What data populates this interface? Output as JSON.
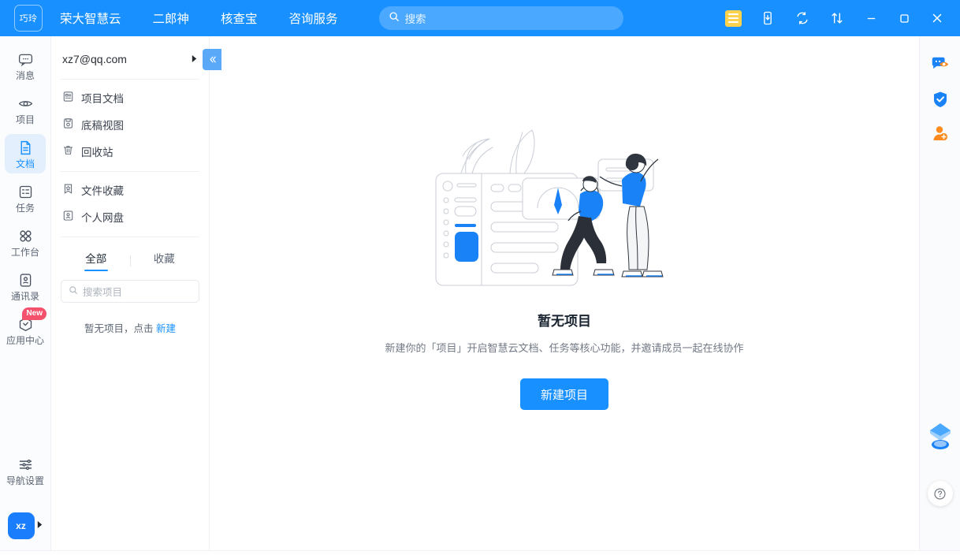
{
  "titlebar": {
    "logo_text": "巧玲",
    "nav_items": [
      {
        "label": "荣大智慧云"
      },
      {
        "label": "二郎神"
      },
      {
        "label": "核查宝"
      },
      {
        "label": "咨询服务"
      }
    ],
    "search_placeholder": "搜索",
    "tool_icons": [
      {
        "name": "note-icon"
      },
      {
        "name": "mobile-download-icon"
      },
      {
        "name": "sync-icon"
      },
      {
        "name": "transfer-icon"
      }
    ],
    "window_controls": [
      {
        "name": "minimize",
        "glyph": "−"
      },
      {
        "name": "maximize",
        "glyph": "▢"
      },
      {
        "name": "close",
        "glyph": "✕"
      }
    ],
    "accent_color": "#1890ff"
  },
  "sidebar": {
    "items": [
      {
        "label": "消息",
        "icon": "message-icon",
        "active": false
      },
      {
        "label": "项目",
        "icon": "project-icon",
        "active": false
      },
      {
        "label": "文档",
        "icon": "document-icon",
        "active": true
      },
      {
        "label": "任务",
        "icon": "task-icon",
        "active": false
      },
      {
        "label": "工作台",
        "icon": "workbench-icon",
        "active": false
      },
      {
        "label": "通讯录",
        "icon": "contacts-icon",
        "active": false
      },
      {
        "label": "应用中心",
        "icon": "app-center-icon",
        "active": false,
        "badge": "New"
      }
    ],
    "settings": {
      "label": "导航设置",
      "icon": "settings-sliders-icon"
    },
    "avatar": {
      "initials": "xz"
    }
  },
  "panel": {
    "account": "xz7@qq.com",
    "groups": [
      [
        {
          "label": "项目文档",
          "icon": "file-doc-icon"
        },
        {
          "label": "底稿视图",
          "icon": "draft-view-icon"
        },
        {
          "label": "回收站",
          "icon": "trash-icon"
        }
      ],
      [
        {
          "label": "文件收藏",
          "icon": "bookmark-star-icon"
        },
        {
          "label": "个人网盘",
          "icon": "personal-drive-icon"
        }
      ]
    ],
    "tabs": [
      {
        "label": "全部",
        "active": true
      },
      {
        "label": "收藏",
        "active": false
      }
    ],
    "search_placeholder": "搜索项目",
    "empty_hint_prefix": "暂无项目，点击 ",
    "empty_hint_link": "新建"
  },
  "main": {
    "empty_title": "暂无项目",
    "empty_desc": "新建你的「项目」开启智慧云文档、任务等核心功能，并邀请成员一起在线协作",
    "create_button": "新建项目",
    "illustration": "team-dashboard-illustration"
  },
  "right_rail": {
    "items": [
      {
        "name": "chat-preview-icon"
      },
      {
        "name": "shield-check-icon"
      },
      {
        "name": "add-contact-icon"
      }
    ],
    "assistant_icon": "assistant-icon",
    "help_label": "?"
  }
}
